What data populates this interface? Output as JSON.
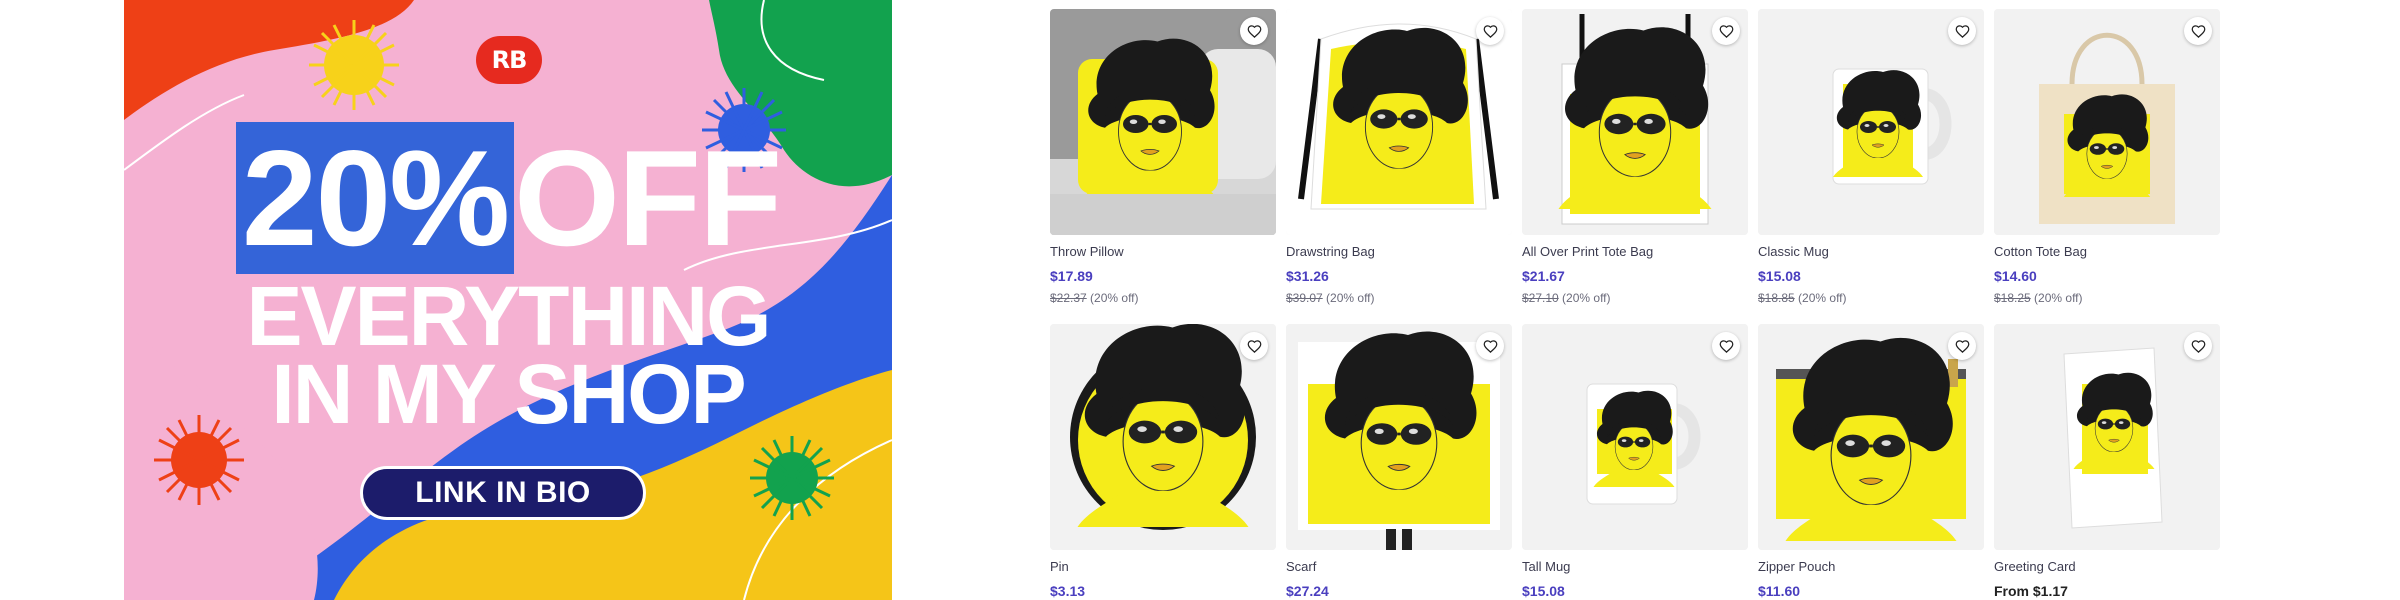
{
  "banner": {
    "logo": "RB",
    "line1_highlight": "20%",
    "line1_rest": "OFF",
    "line2": "EVERYTHING",
    "line3": "IN MY SHOP",
    "cta": "LINK IN BIO",
    "colors": {
      "pink": "#f5b1d2",
      "green": "#12a24e",
      "blue": "#2f5ee0",
      "yellow": "#f5c518",
      "orange": "#ee4016",
      "navy": "#1c1c6b"
    }
  },
  "products": [
    {
      "name": "Throw Pillow",
      "price": "$17.89",
      "original": "$22.37",
      "discount": "(20% off)",
      "kind": "pillow"
    },
    {
      "name": "Drawstring Bag",
      "price": "$31.26",
      "original": "$39.07",
      "discount": "(20% off)",
      "kind": "drawstring"
    },
    {
      "name": "All Over Print Tote Bag",
      "price": "$21.67",
      "original": "$27.10",
      "discount": "(20% off)",
      "kind": "tote-aop"
    },
    {
      "name": "Classic Mug",
      "price": "$15.08",
      "original": "$18.85",
      "discount": "(20% off)",
      "kind": "mug"
    },
    {
      "name": "Cotton Tote Bag",
      "price": "$14.60",
      "original": "$18.25",
      "discount": "(20% off)",
      "kind": "tote-cotton"
    },
    {
      "name": "Pin",
      "price": "$3.13",
      "kind": "pin"
    },
    {
      "name": "Scarf",
      "price": "$27.24",
      "kind": "scarf"
    },
    {
      "name": "Tall Mug",
      "price": "$15.08",
      "kind": "tall-mug"
    },
    {
      "name": "Zipper Pouch",
      "price": "$11.60",
      "kind": "pouch"
    },
    {
      "name": "Greeting Card",
      "price": "From $1.17",
      "kind": "card"
    }
  ],
  "icons": {
    "favorite": "heart-outline-icon"
  },
  "accent": {
    "price": "#4a3fbf",
    "art_yellow": "#f5ec1a"
  }
}
